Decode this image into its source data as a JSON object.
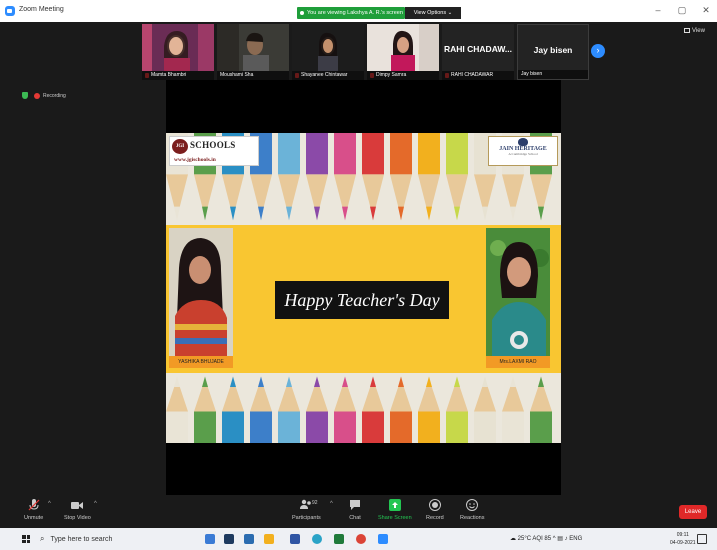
{
  "window": {
    "title": "Zoom Meeting",
    "share_banner": "You are viewing Lakshya A. R.'s screen",
    "view_options": "View Options",
    "view_button": "View",
    "recording": "Recording"
  },
  "participants": [
    {
      "name": "Mamta Bhambri",
      "muted": true
    },
    {
      "name": "Moushami Sha",
      "muted": false
    },
    {
      "name": "Shayanee Chintawar",
      "muted": true
    },
    {
      "name": "Dimpy Samra",
      "muted": true
    },
    {
      "name": "RAHI CHADAWAR",
      "big_label": "RAHI CHADAW...",
      "muted": true
    },
    {
      "name": "Jay bisen",
      "big_label": "Jay bisen",
      "muted": false
    }
  ],
  "slide": {
    "jgi_badge": "JGI",
    "jgi_name": "SCHOOLS",
    "jgi_url": "www.jgischools.in",
    "jain_name": "JAIN HERITAGE",
    "jain_sub": "A Cambridge School",
    "greeting": "Happy Teacher's Day",
    "left_photo_label": "YASHIKA BHUJADE",
    "right_photo_label": "Mrs.LAXMI RAO"
  },
  "toolbar": {
    "unmute": "Unmute",
    "stop_video": "Stop Video",
    "participants": "Participants",
    "participant_count": "92",
    "chat": "Chat",
    "share_screen": "Share Screen",
    "record": "Record",
    "reactions": "Reactions",
    "leave": "Leave"
  },
  "taskbar": {
    "search_placeholder": "Type here to search",
    "weather": "25°C AQI 85",
    "language": "ENG",
    "time": "09:11",
    "date": "04-09-2021"
  },
  "colors": {
    "zoom_blue": "#2d8cff",
    "share_green": "#1f9e3a",
    "leave_red": "#e02828",
    "slide_yellow": "#f9c631"
  }
}
